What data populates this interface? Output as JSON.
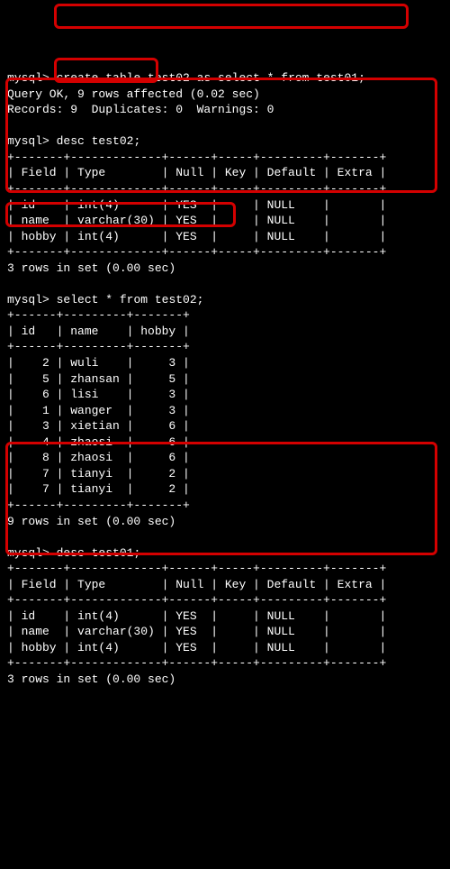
{
  "prompt": "mysql>",
  "cmd1": "create table test02 as select * from test01;",
  "res1a": "Query OK, 9 rows affected (0.02 sec)",
  "res1b": "Records: 9  Duplicates: 0  Warnings: 0",
  "cmd2": "desc test02;",
  "desc_sep": "+-------+-------------+------+-----+---------+-------+",
  "desc_head": "| Field | Type        | Null | Key | Default | Extra |",
  "desc_rows": [
    "| id    | int(4)      | YES  |     | NULL    |       |",
    "| name  | varchar(30) | YES  |     | NULL    |       |",
    "| hobby | int(4)      | YES  |     | NULL    |       |"
  ],
  "desc_footer": "3 rows in set (0.00 sec)",
  "cmd3": "select * from test02;",
  "sel_sep": "+------+---------+-------+",
  "sel_head": "| id   | name    | hobby |",
  "sel_rows": [
    "|    2 | wuli    |     3 |",
    "|    5 | zhansan |     5 |",
    "|    6 | lisi    |     3 |",
    "|    1 | wanger  |     3 |",
    "|    3 | xietian |     6 |",
    "|    4 | zhaosi  |     6 |",
    "|    8 | zhaosi  |     6 |",
    "|    7 | tianyi  |     2 |",
    "|    7 | tianyi  |     2 |"
  ],
  "sel_footer": "9 rows in set (0.00 sec)",
  "cmd4": "desc test01;",
  "desc2_footer": "3 rows in set (0.00 sec)"
}
